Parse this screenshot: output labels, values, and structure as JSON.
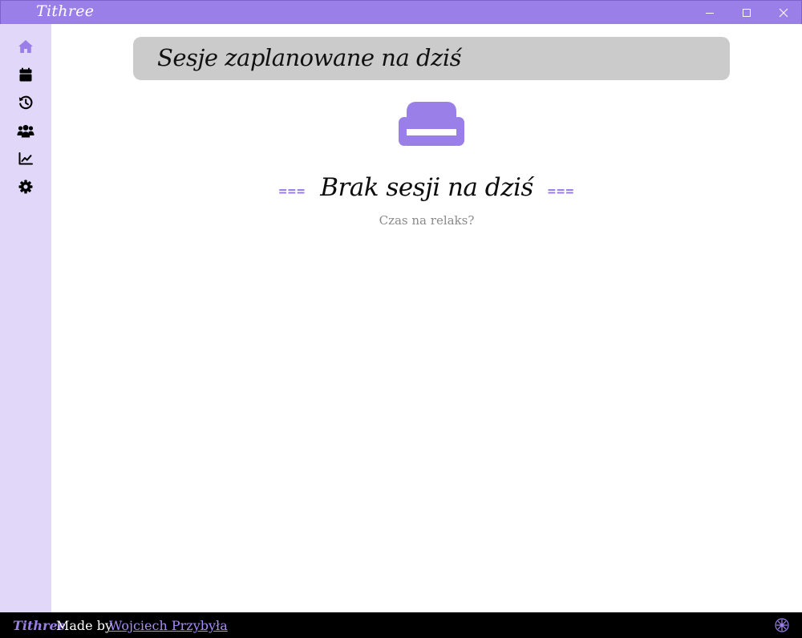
{
  "window": {
    "title": "Tithree",
    "controls": [
      "minimize-icon",
      "maximize-icon",
      "close-icon"
    ]
  },
  "sidebar": {
    "items": [
      {
        "name": "home",
        "icon": "home-icon",
        "active": true
      },
      {
        "name": "calendar",
        "icon": "calendar-icon",
        "active": false
      },
      {
        "name": "history",
        "icon": "history-icon",
        "active": false
      },
      {
        "name": "clients",
        "icon": "users-icon",
        "active": false
      },
      {
        "name": "stats",
        "icon": "chart-line-icon",
        "active": false
      },
      {
        "name": "settings",
        "icon": "gear-icon",
        "active": false
      }
    ]
  },
  "main": {
    "header": "Sesje zaplanowane na dziś",
    "empty_state": {
      "icon": "sofa-icon",
      "decoration": "===",
      "title": "Brak sesji na dziś",
      "subtitle": "Czas na relaks?"
    }
  },
  "footer": {
    "brand": "Tithree",
    "made_by": "Made by",
    "author": "Wojciech Przybyła",
    "badge_icon": "flower-icon"
  },
  "colors": {
    "accent": "#9b7fe8",
    "sidebar_bg": "#e1d7f8",
    "header_bg": "#cbcbcb",
    "footer_bg": "#000000"
  }
}
